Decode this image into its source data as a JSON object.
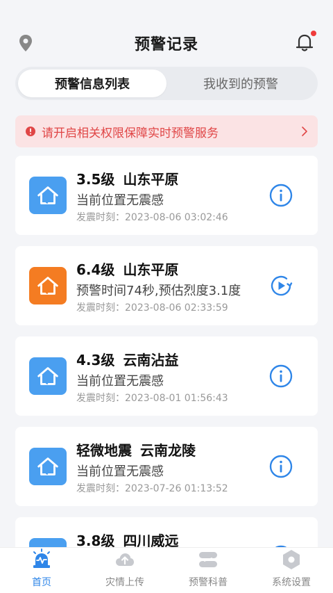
{
  "header": {
    "title": "预警记录"
  },
  "tabs": [
    {
      "label": "预警信息列表",
      "active": true
    },
    {
      "label": "我收到的预警",
      "active": false
    }
  ],
  "notice": {
    "text": "请开启相关权限保障实时预警服务"
  },
  "records": [
    {
      "magnitude": "3.5级",
      "location": "山东平原",
      "detail": "当前位置无震感",
      "time": "发震时刻：2023-08-06 03:02:46",
      "icon_color": "#4a9ff0",
      "action": "info-icon"
    },
    {
      "magnitude": "6.4级",
      "location": "山东平原",
      "detail": "预警时间74秒,预估烈度3.1度",
      "time": "发震时刻：2023-08-06 02:33:59",
      "icon_color": "#f47c22",
      "action": "replay-icon"
    },
    {
      "magnitude": "4.3级",
      "location": "云南沾益",
      "detail": "当前位置无震感",
      "time": "发震时刻：2023-08-01 01:56:43",
      "icon_color": "#4a9ff0",
      "action": "info-icon"
    },
    {
      "magnitude": "轻微地震",
      "location": "云南龙陵",
      "detail": "当前位置无震感",
      "time": "发震时刻：2023-07-26 01:13:52",
      "icon_color": "#4a9ff0",
      "action": "info-icon"
    },
    {
      "magnitude": "3.8级",
      "location": "四川威远",
      "detail": "",
      "time": "",
      "icon_color": "#4a9ff0",
      "action": "info-icon"
    }
  ],
  "bottom_nav": [
    {
      "label": "首页",
      "icon": "alarm-icon",
      "active": true
    },
    {
      "label": "灾情上传",
      "icon": "cloud-upload-icon",
      "active": false
    },
    {
      "label": "预警科普",
      "icon": "book-icon",
      "active": false
    },
    {
      "label": "系统设置",
      "icon": "settings-icon",
      "active": false
    }
  ],
  "colors": {
    "accent": "#2f86e8",
    "notice_bg": "#fbe3e4",
    "notice_text": "#e04646",
    "badge_red": "#ef3b3b"
  }
}
